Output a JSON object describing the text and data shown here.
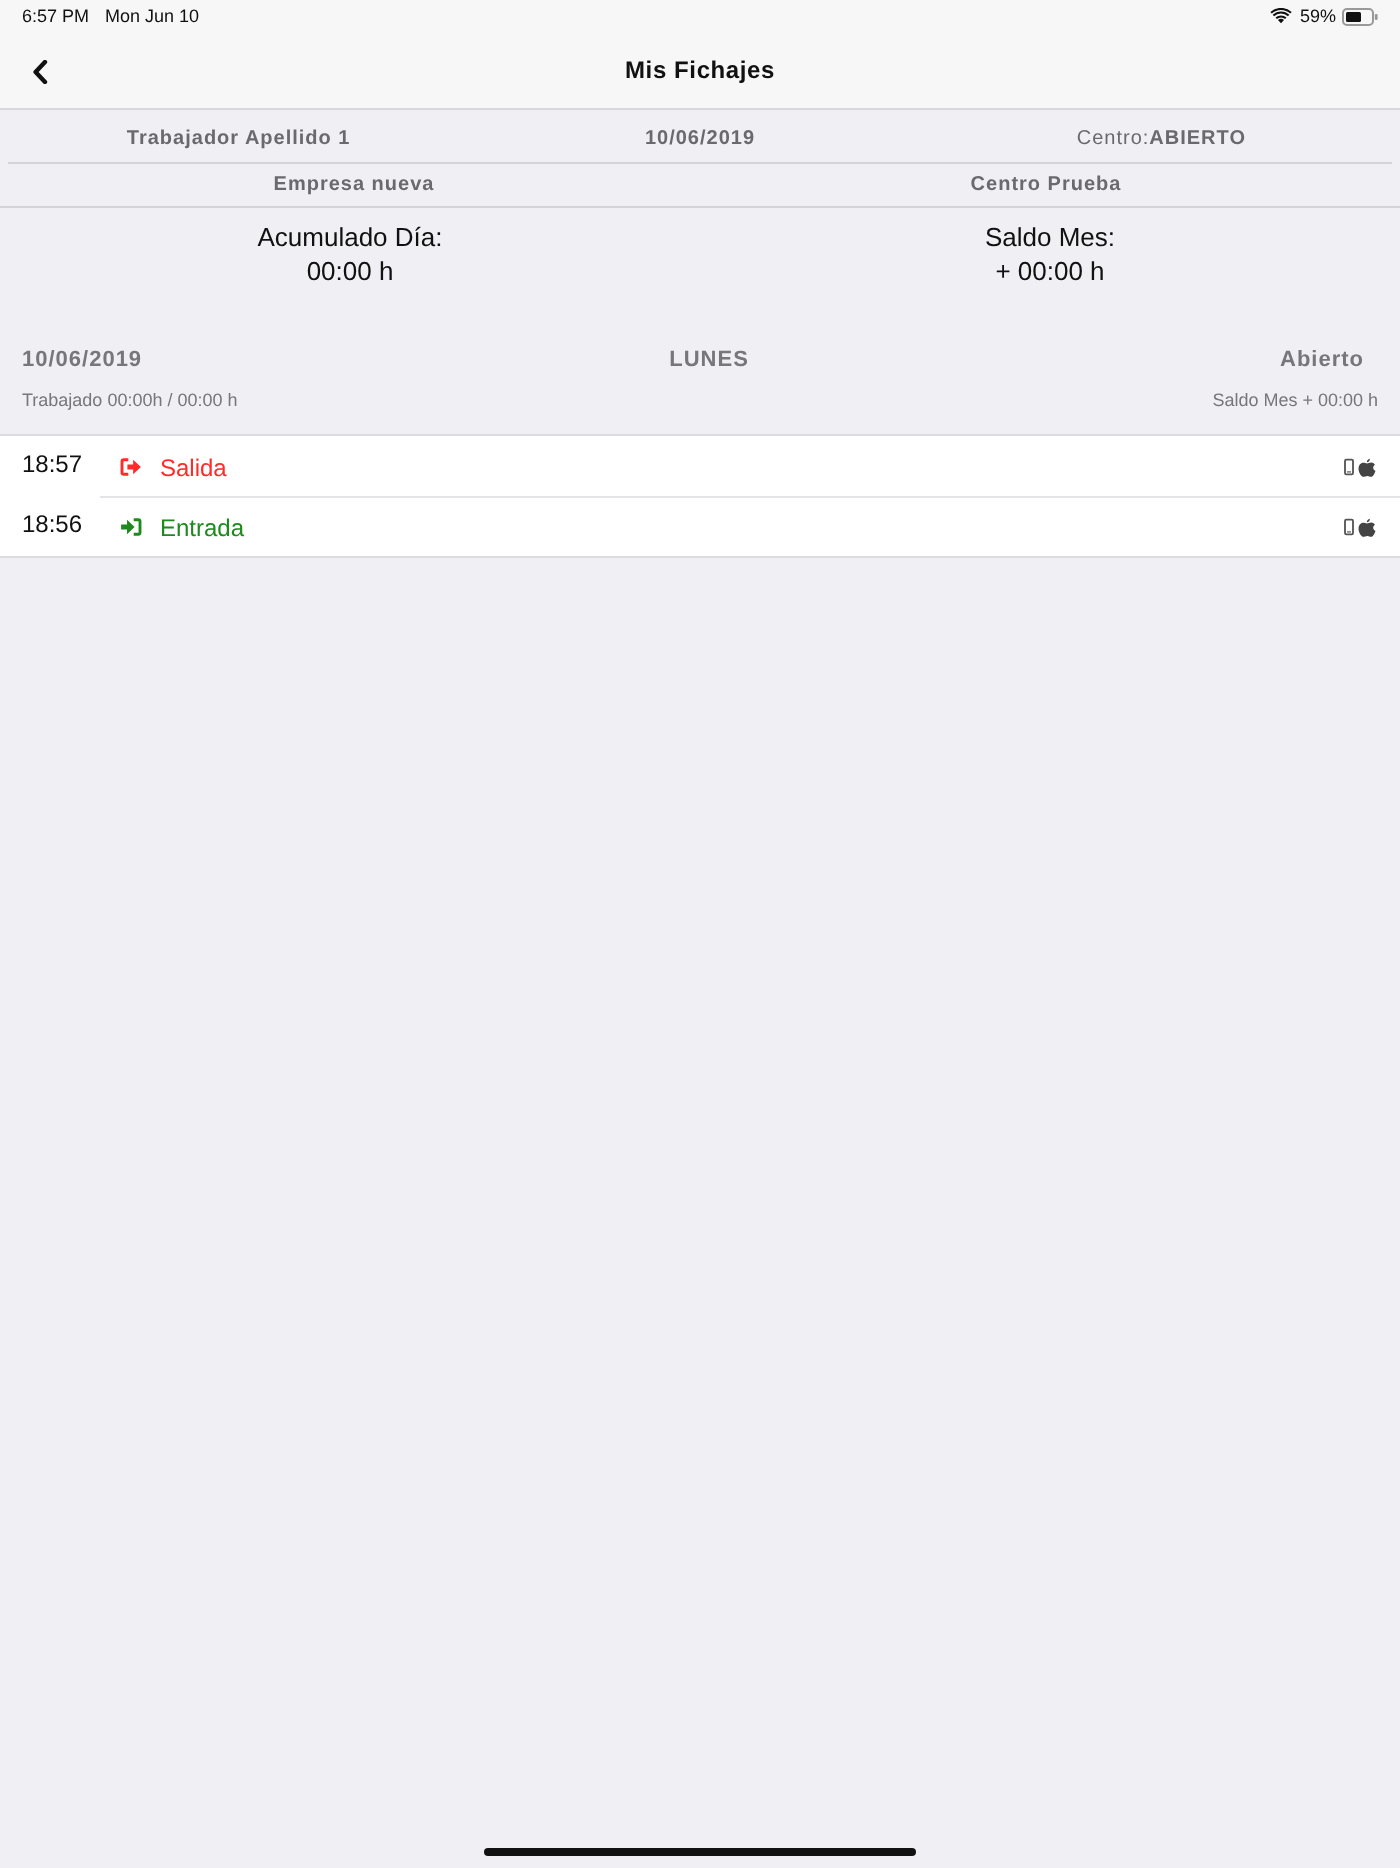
{
  "status_bar": {
    "time": "6:57 PM",
    "date": "Mon Jun 10",
    "battery": "59%"
  },
  "nav": {
    "title": "Mis Fichajes"
  },
  "info": {
    "row_1": [
      "Trabajador Apellido 1",
      "10/06/2019",
      "Centro:**ABIERTO**"
    ],
    "row_2": [
      "Empresa nueva",
      "Centro Prueba"
    ]
  },
  "summary": [
    {
      "label": "Acumulado Día:",
      "value": "00:00 h"
    },
    {
      "label": "Saldo Mes:",
      "value": "+ 00:00 h"
    }
  ],
  "day": {
    "date": "10/06/2019",
    "weekday": "LUNES",
    "status": "Abierto",
    "worked": "Trabajado 00:00h / 00:00 h",
    "balance": "Saldo Mes + 00:00 h"
  },
  "entries": [
    {
      "time": "18:57",
      "kind": "out",
      "label": "Salida",
      "color": "#ff2a2a"
    },
    {
      "time": "18:56",
      "kind": "in",
      "label": "Entrada",
      "color": "#1e8a1e"
    }
  ]
}
